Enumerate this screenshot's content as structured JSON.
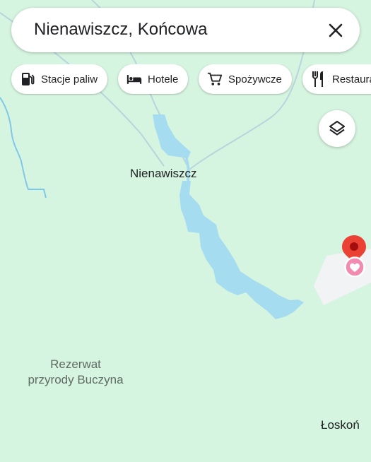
{
  "search": {
    "query": "Nienawiszcz, Końcowa"
  },
  "chips": [
    {
      "label": "Stacje paliw",
      "icon": "gas-station-icon"
    },
    {
      "label": "Hotele",
      "icon": "bed-icon"
    },
    {
      "label": "Spożywcze",
      "icon": "cart-icon"
    },
    {
      "label": "Restaurac",
      "icon": "restaurant-icon"
    }
  ],
  "map": {
    "places": {
      "village": "Nienawiszcz",
      "reserve_line1": "Rezerwat",
      "reserve_line2": "przyrody Buczyna",
      "town": "Łoskoń"
    },
    "colors": {
      "land": "#d6f5e0",
      "water": "#a5dcf0",
      "road": "#b9d4dc",
      "area": "#f1f3f4",
      "pin": "#ea4335"
    }
  }
}
